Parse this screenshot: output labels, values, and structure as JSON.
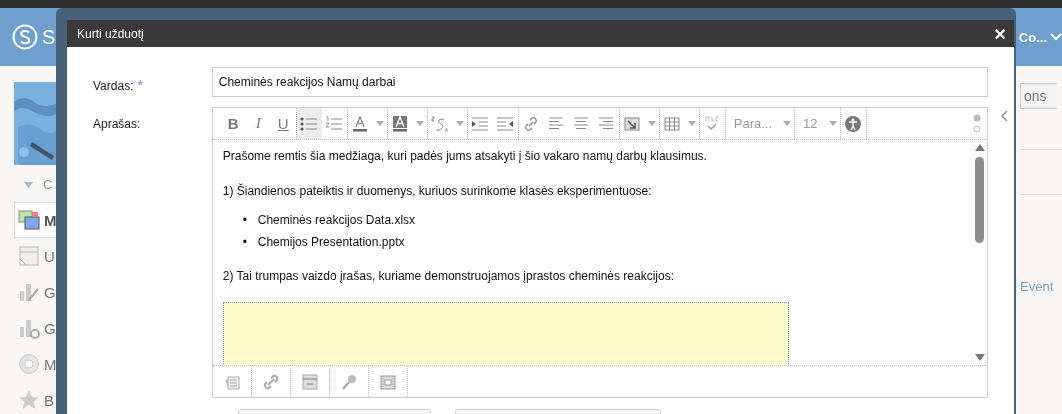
{
  "app": {
    "logo_text": "S",
    "header_text": "Co...",
    "section_label": "C",
    "nav": [
      {
        "label": "M",
        "kind": "pictures",
        "selected": true
      },
      {
        "label": "U",
        "kind": "page",
        "selected": false
      },
      {
        "label": "G",
        "kind": "chart-pen",
        "selected": false
      },
      {
        "label": "G",
        "kind": "chart-gear",
        "selected": false
      },
      {
        "label": "M",
        "kind": "disc",
        "selected": false
      },
      {
        "label": "B",
        "kind": "star",
        "selected": false
      }
    ],
    "side_button": "ons",
    "side_link": "Event"
  },
  "dialog": {
    "title": "Kurti užduotį",
    "close": "×",
    "name_field": {
      "label": "Vardas:",
      "required_mark": "*",
      "value": "Cheminės reakcijos Namų darbai"
    },
    "editor": {
      "label": "Aprašas:",
      "toolbar": [
        [
          {
            "kind": "bold",
            "label": "B",
            "active": false
          },
          {
            "kind": "italic",
            "label": "I",
            "active": false
          },
          {
            "kind": "underline",
            "label": "U",
            "active": false
          }
        ],
        [
          {
            "kind": "bullets",
            "active": true
          },
          {
            "kind": "numbers",
            "active": false
          }
        ],
        [
          {
            "kind": "font-color",
            "active": false
          },
          {
            "kind": "caret"
          }
        ],
        [
          {
            "kind": "highlight",
            "active": false
          },
          {
            "kind": "caret"
          }
        ],
        [
          {
            "kind": "superscript",
            "active": false
          },
          {
            "kind": "caret"
          }
        ],
        [
          {
            "kind": "indent",
            "active": false
          },
          {
            "kind": "outdent",
            "active": false
          }
        ],
        [
          {
            "kind": "link",
            "active": false
          },
          {
            "kind": "align-left",
            "active": false
          },
          {
            "kind": "align-center",
            "active": false
          },
          {
            "kind": "align-right",
            "active": false
          }
        ],
        [
          {
            "kind": "insert",
            "active": false
          },
          {
            "kind": "caret"
          }
        ],
        [
          {
            "kind": "table",
            "active": false
          },
          {
            "kind": "caret"
          }
        ],
        [
          {
            "kind": "spellcheck",
            "active": false
          }
        ],
        [
          {
            "kind": "format",
            "label": "Para...",
            "active": false
          },
          {
            "kind": "caret"
          }
        ],
        [
          {
            "kind": "size",
            "label": "12",
            "active": false
          },
          {
            "kind": "caret"
          }
        ],
        [
          {
            "kind": "accessibility",
            "active": false
          }
        ]
      ],
      "content": [
        {
          "kind": "paragraph",
          "text": "Prašome remtis šia medžiaga, kuri padės jums atsakyti į šio vakaro namų darbų klausimus."
        },
        {
          "kind": "paragraph",
          "text": "1) Šiandienos pateiktis ir duomenys, kuriuos surinkome klasės eksperimentuose:"
        },
        {
          "kind": "list",
          "marker": "•",
          "items": [
            "Cheminės reakcijos Data.xlsx",
            "Chemijos Presentation.pptx"
          ]
        },
        {
          "kind": "paragraph",
          "text": "2) Tai trumpas vaizdo įrašas, kuriame demonstruojamos įprastos cheminės reakcijos:"
        },
        {
          "kind": "media"
        }
      ],
      "media_buttons": [
        {
          "kind": "document"
        },
        {
          "kind": "link"
        },
        {
          "kind": "box"
        },
        {
          "kind": "microphone"
        },
        {
          "kind": "film"
        }
      ]
    }
  }
}
